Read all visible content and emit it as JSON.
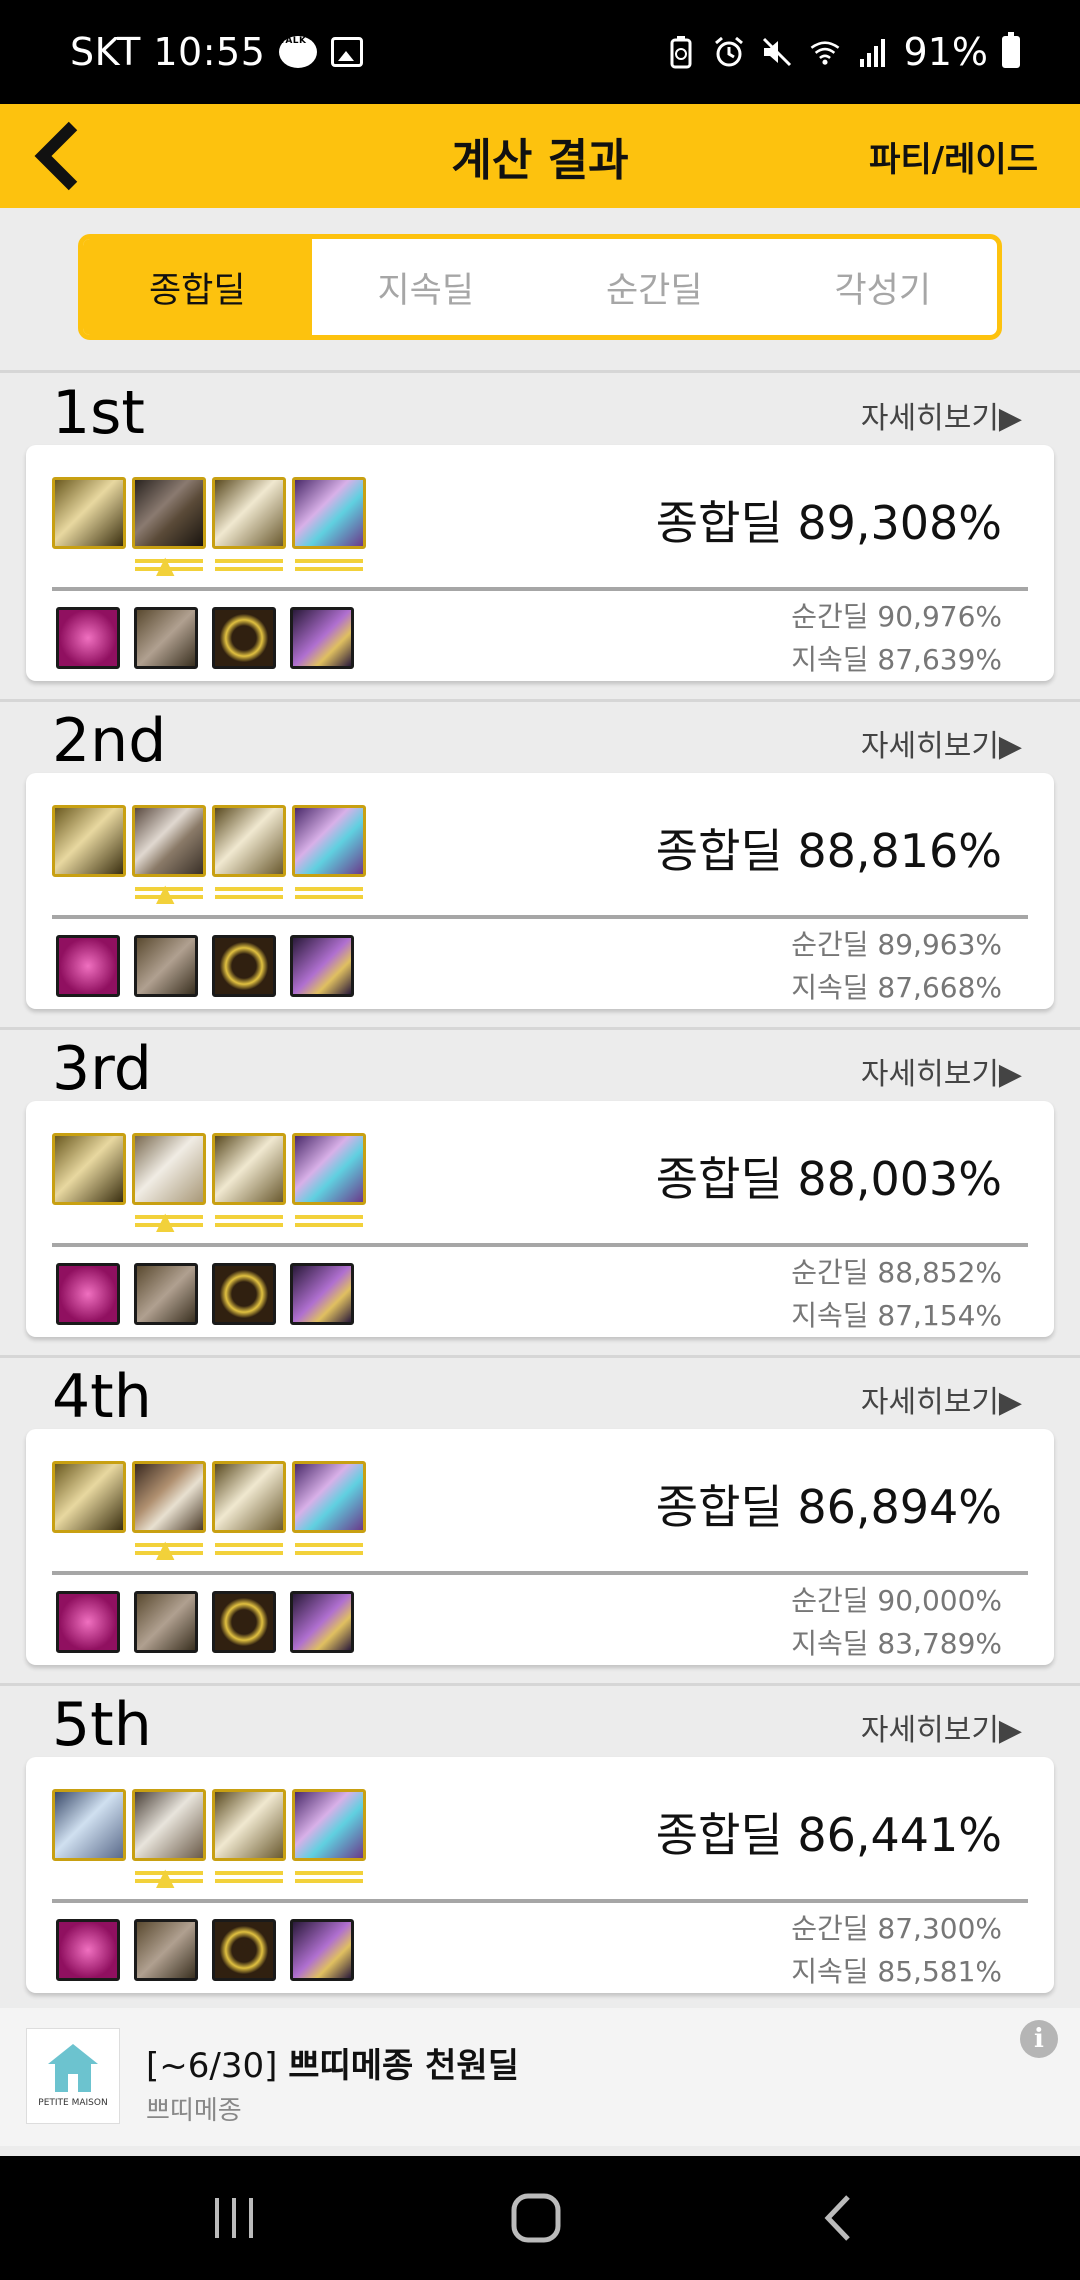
{
  "status_bar": {
    "carrier_time": "SKT 10:55",
    "talk_icon_text": "TALK",
    "battery_percent": "91%"
  },
  "header": {
    "title": "계산 결과",
    "right_button": "파티/레이드"
  },
  "tabs": [
    {
      "label": "종합딜",
      "active": true
    },
    {
      "label": "지속딜",
      "active": false
    },
    {
      "label": "순간딜",
      "active": false
    },
    {
      "label": "각성기",
      "active": false
    }
  ],
  "results": [
    {
      "rank": "1st",
      "detail_label": "자세히보기▶",
      "total": "종합딜 89,308%",
      "burst": "순간딜 90,976%",
      "sustain": "지속딜 87,639%"
    },
    {
      "rank": "2nd",
      "detail_label": "자세히보기▶",
      "total": "종합딜 88,816%",
      "burst": "순간딜 89,963%",
      "sustain": "지속딜 87,668%"
    },
    {
      "rank": "3rd",
      "detail_label": "자세히보기▶",
      "total": "종합딜 88,003%",
      "burst": "순간딜 88,852%",
      "sustain": "지속딜 87,154%"
    },
    {
      "rank": "4th",
      "detail_label": "자세히보기▶",
      "total": "종합딜 86,894%",
      "burst": "순간딜 90,000%",
      "sustain": "지속딜 83,789%"
    },
    {
      "rank": "5th",
      "detail_label": "자세히보기▶",
      "total": "종합딜 86,441%",
      "burst": "순간딜 87,300%",
      "sustain": "지속딜 85,581%"
    }
  ],
  "ad": {
    "title_prefix": "[~6/30] ",
    "title_bold": "쁘띠메종 천원딜",
    "subtitle": "쁘띠메종",
    "logo_text": "PETITE MAISON"
  },
  "colors": {
    "accent": "#fdc20e",
    "gear_border": "#c8a012",
    "mark": "#f2d13a"
  }
}
